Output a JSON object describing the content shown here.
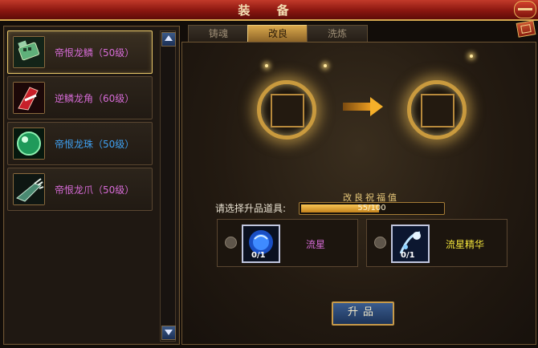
{
  "window": {
    "title": "装 备"
  },
  "equipment_list": [
    {
      "label": "帝恨龙鳞（50级）",
      "color": "#d66bd6",
      "icon": "green-talisman-icon",
      "selected": true
    },
    {
      "label": "逆鳞龙角（60级）",
      "color": "#d66bd6",
      "icon": "red-horn-blade-icon",
      "selected": false
    },
    {
      "label": "帝恨龙珠（50级）",
      "color": "#3fa1f2",
      "icon": "green-orb-icon",
      "selected": false
    },
    {
      "label": "帝恨龙爪（50级）",
      "color": "#d66bd6",
      "icon": "dragon-claw-icon",
      "selected": false
    }
  ],
  "tabs": [
    {
      "label": "铸魂",
      "active": false
    },
    {
      "label": "改良",
      "active": true
    },
    {
      "label": "洗炼",
      "active": false
    }
  ],
  "upgrade": {
    "prompt": "请选择升品道具:",
    "bless_label": "改良祝福值",
    "bless_value": 55,
    "bless_max": 100,
    "bless_text": "55/100",
    "materials": [
      {
        "name": "流星",
        "count": "0/1",
        "name_color": "#d66bd6",
        "icon": "blue-meteor-orb-icon"
      },
      {
        "name": "流星精华",
        "count": "0/1",
        "name_color": "#f2e33b",
        "icon": "meteor-essence-icon"
      }
    ],
    "button_label": "升品"
  }
}
